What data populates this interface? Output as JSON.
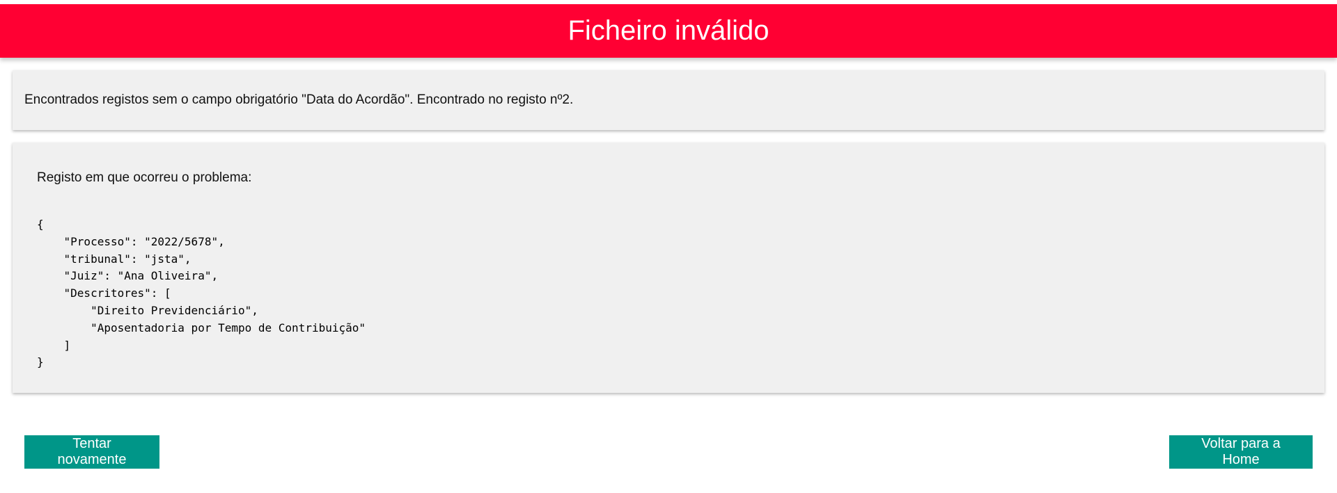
{
  "header": {
    "title": "Ficheiro inválido"
  },
  "error": {
    "message": "Encontrados registos sem o campo obrigatório \"Data do Acordão\". Encontrado no registo nº2."
  },
  "record": {
    "label": "Registo em que ocorreu o problema:",
    "json": "{\n    \"Processo\": \"2022/5678\",\n    \"tribunal\": \"jsta\",\n    \"Juiz\": \"Ana Oliveira\",\n    \"Descritores\": [\n        \"Direito Previdenciário\",\n        \"Aposentadoria por Tempo de Contribuição\"\n    ]\n}"
  },
  "actions": {
    "retry_label": "Tentar novamente",
    "home_label": "Voltar para a Home"
  },
  "colors": {
    "header_bg": "#ff0033",
    "button_bg": "#009688",
    "card_bg": "#f0f0f0"
  }
}
